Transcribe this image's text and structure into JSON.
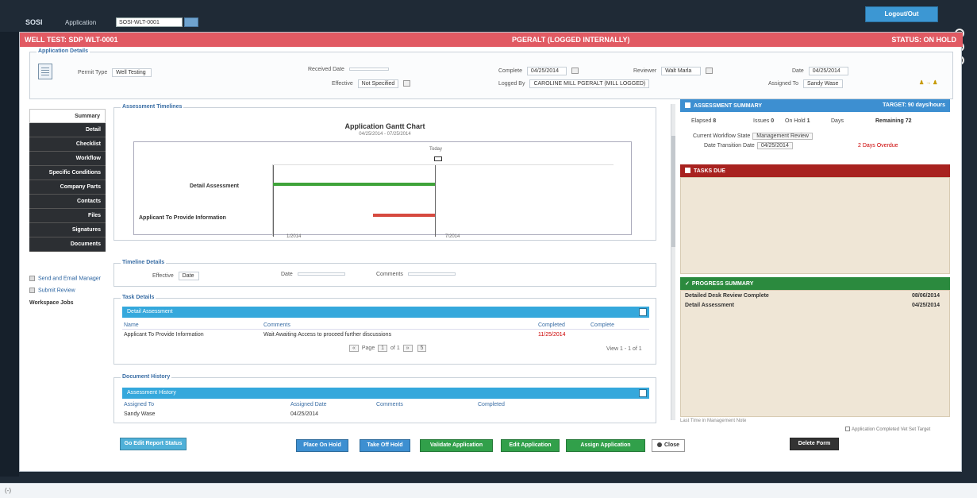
{
  "outer": {
    "app_name": "SOSI",
    "search_label": "Application",
    "search_value": "SOSI-WLT-0001",
    "user_button": "Logout/Out",
    "footer_left": "(-)"
  },
  "header": {
    "left": "WELL TEST: SDP WLT-0001",
    "center": "PGERALT (LOGGED INTERNALLY)",
    "right": "STATUS: ON HOLD"
  },
  "app_details": {
    "legend": "Application Details",
    "fields": [
      {
        "label": "Permit Type",
        "value": "Well Testing"
      },
      {
        "label": "Received Date",
        "value": ""
      },
      {
        "label": "Effective",
        "value": "Not Specified"
      },
      {
        "label": "Complete",
        "value": "04/25/2014"
      },
      {
        "label": "Logged By",
        "value": "CAROLINE MILL PGERALT (MILL LOGGED)"
      },
      {
        "label": "Reviewer",
        "value": "Walt Marla"
      },
      {
        "label": "Date",
        "value": "04/25/2014"
      },
      {
        "label": "Assigned To",
        "value": "Sandy Wase"
      }
    ]
  },
  "nav": {
    "items": [
      "Summary",
      "Detail",
      "Checklist",
      "Workflow",
      "Specific Conditions",
      "Company Parts",
      "Contacts",
      "Files",
      "Signatures",
      "Documents"
    ],
    "links": [
      "Send and Email Manager",
      "Submit Review",
      "Workspace Jobs"
    ]
  },
  "assessment": {
    "legend": "Assessment Timelines",
    "chart_title": "Application Gantt Chart",
    "chart_sub": "04/25/2014 - 07/25/2014",
    "today_label": "Today",
    "tick_start": "1/2014",
    "tick_end": "7/2014",
    "rows": [
      "Detail Assessment",
      "Applicant To Provide Information"
    ]
  },
  "timeline_details": {
    "legend": "Timeline Details",
    "fields": [
      {
        "label": "Effective",
        "value": "Date"
      },
      {
        "label": "Date",
        "value": ""
      },
      {
        "label": "Comments",
        "value": ""
      }
    ]
  },
  "task_details": {
    "legend": "Task Details",
    "head": "Detail Assessment",
    "columns": [
      "Name",
      "Comments",
      "Completed",
      "Complete"
    ],
    "rows": [
      {
        "name": "Applicant To Provide Information",
        "comments": "Wait Awaiting Access to proceed further discussions",
        "completed": "11/25/2014"
      }
    ],
    "pager": {
      "page_label": "Page",
      "page_value": "1",
      "of_label": "of 1",
      "per_page": "5",
      "view": "View 1 - 1 of 1"
    }
  },
  "document_history": {
    "legend": "Document History",
    "head": "Assessment History",
    "columns": [
      "Assigned To",
      "Assigned Date",
      "Comments",
      "Completed"
    ],
    "rows": [
      {
        "assigned_to": "Sandy Wase",
        "date": "04/25/2014"
      }
    ]
  },
  "assessment_summary": {
    "title": "ASSESSMENT SUMMARY",
    "target": "TARGET: 90 days/hours",
    "stats": [
      {
        "label": "Elapsed",
        "value": "8"
      },
      {
        "label": "Issues",
        "value": "0"
      },
      {
        "label": "On Hold",
        "value": "1"
      },
      {
        "label": "Days",
        "value": ""
      },
      {
        "label": "Remaining",
        "value": "72"
      }
    ],
    "current_label": "Current Workflow State",
    "current_value": "Management Review",
    "date_label": "Date Transition Date",
    "date_value": "04/25/2014",
    "overdue": "2 Days Overdue"
  },
  "tasks_due": {
    "title": "TASKS DUE"
  },
  "progress_summary": {
    "title": "PROGRESS SUMMARY",
    "items": [
      {
        "label": "Detailed Desk Review Complete",
        "date": "08/06/2014"
      },
      {
        "label": "Detail Assessment",
        "date": "04/25/2014"
      }
    ],
    "footer_note": "Last Time in Management Note",
    "check_label": "Application Completed Vet Set Target"
  },
  "buttons": {
    "left": "Go Edit Report Status",
    "place_on_hold": "Place On Hold",
    "take_off_hold": "Take Off Hold",
    "validate": "Validate Application",
    "edit": "Edit Application",
    "assign": "Assign Application",
    "close": "Close",
    "delete": "Delete Form"
  },
  "colors": {
    "header_red": "#e15a63",
    "task_blue": "#35a8dc",
    "summary_blue": "#3d8fd1",
    "tasks_red": "#a8221f",
    "progress_green": "#2b8a3e",
    "gantt_green": "#3fa33a",
    "gantt_red": "#d64a3f"
  }
}
